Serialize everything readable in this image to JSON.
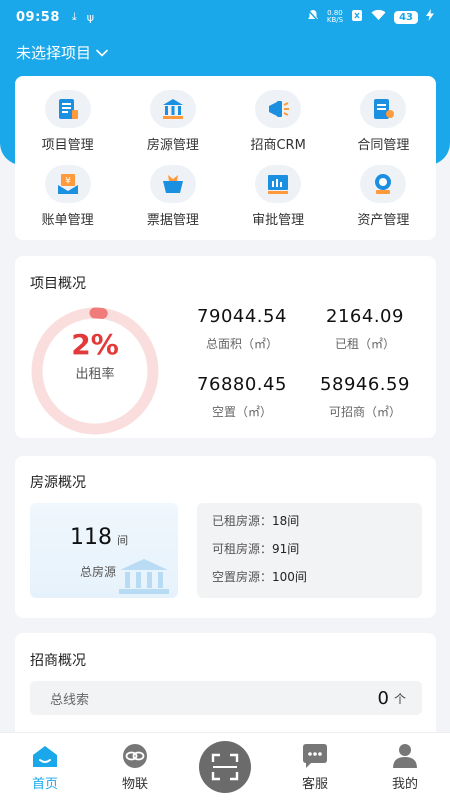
{
  "status_bar": {
    "time": "09:58",
    "network_speed_value": "0.80",
    "network_speed_unit": "KB/S",
    "battery": "43"
  },
  "header": {
    "project_select": "未选择项目"
  },
  "menu": [
    {
      "label": "项目管理",
      "icon": "project-icon"
    },
    {
      "label": "房源管理",
      "icon": "building-icon"
    },
    {
      "label": "招商CRM",
      "icon": "megaphone-icon"
    },
    {
      "label": "合同管理",
      "icon": "contract-icon"
    },
    {
      "label": "账单管理",
      "icon": "bill-icon"
    },
    {
      "label": "票据管理",
      "icon": "receipt-icon"
    },
    {
      "label": "审批管理",
      "icon": "approval-icon"
    },
    {
      "label": "资产管理",
      "icon": "asset-icon"
    }
  ],
  "project_overview": {
    "title": "项目概况",
    "rent_rate": 0.02,
    "rent_rate_text": "2%",
    "rent_rate_label": "出租率",
    "stats": [
      {
        "value": "79044.54",
        "label": "总面积（㎡）"
      },
      {
        "value": "2164.09",
        "label": "已租（㎡）"
      },
      {
        "value": "76880.45",
        "label": "空置（㎡）"
      },
      {
        "value": "58946.59",
        "label": "可招商（㎡）"
      }
    ]
  },
  "house_overview": {
    "title": "房源概况",
    "total_count": "118",
    "total_unit": "间",
    "total_label": "总房源",
    "rows": [
      {
        "label": "已租房源：",
        "value": "18间"
      },
      {
        "label": "可租房源：",
        "value": "91间"
      },
      {
        "label": "空置房源：",
        "value": "100间"
      }
    ]
  },
  "lead_overview": {
    "title": "招商概况",
    "total_label": "总线索",
    "total_value": "0",
    "total_unit": "个"
  },
  "tabbar": [
    {
      "label": "首页",
      "icon": "home-icon",
      "active": true
    },
    {
      "label": "物联",
      "icon": "iot-link-icon",
      "active": false
    },
    {
      "label": "",
      "icon": "scan-icon",
      "active": false
    },
    {
      "label": "客服",
      "icon": "chat-icon",
      "active": false
    },
    {
      "label": "我的",
      "icon": "user-icon",
      "active": false
    }
  ],
  "colors": {
    "primary": "#1ba8ea",
    "rate_red": "#e23a3a",
    "ring_bg": "#fadede",
    "ring_fg": "#f07b7b"
  }
}
